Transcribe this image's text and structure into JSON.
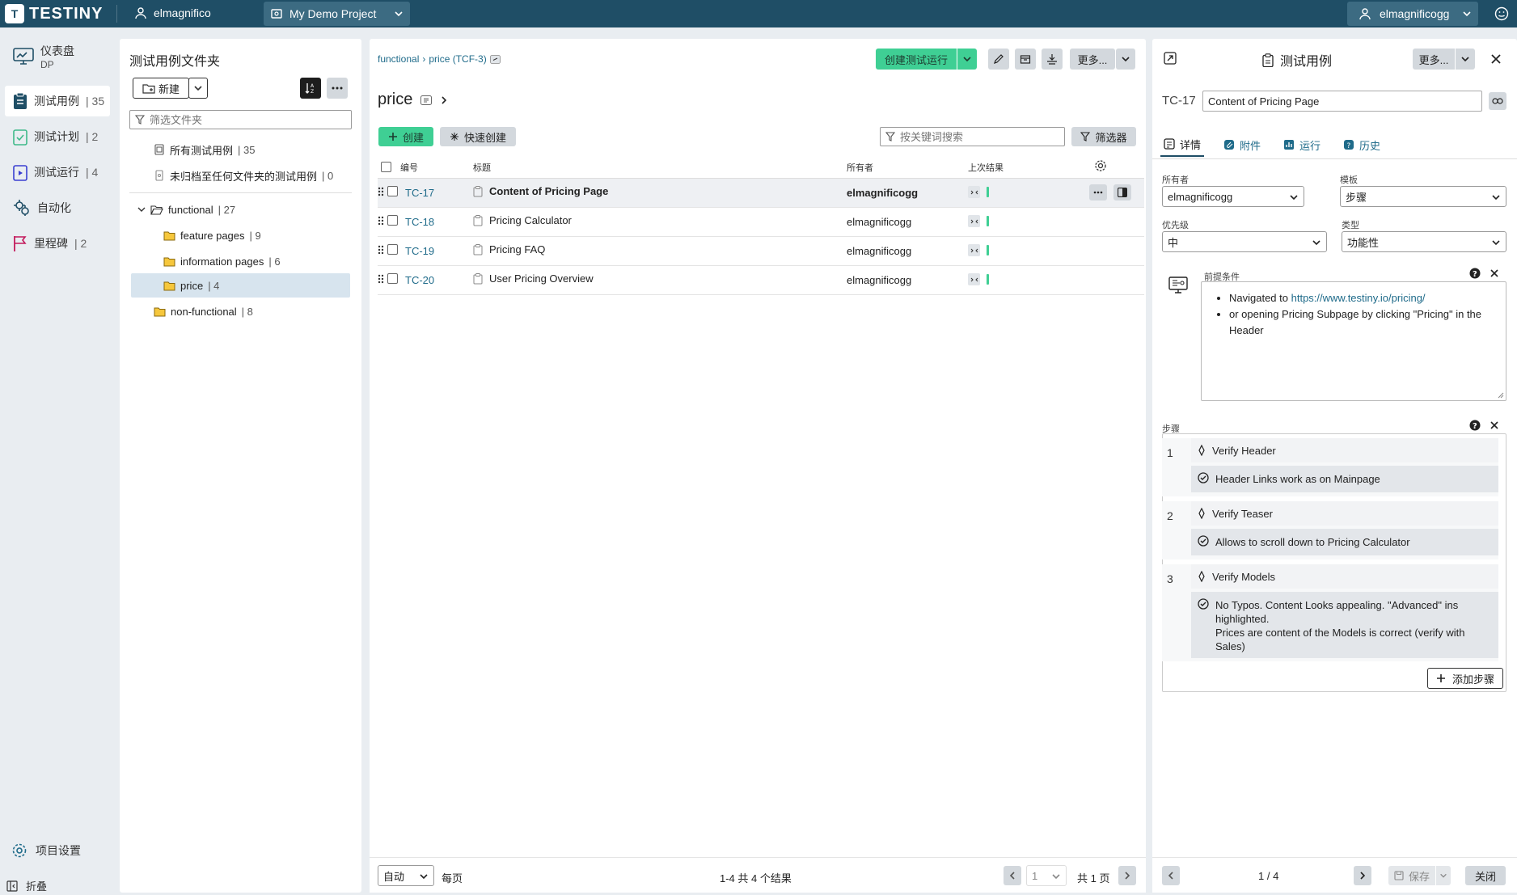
{
  "app": {
    "brand": "TESTINY",
    "org": "elmagnifico",
    "project": "My Demo Project",
    "user": "elmagnificogg"
  },
  "nav": {
    "items": [
      {
        "label": "仪表盘",
        "sub": "DP",
        "count": ""
      },
      {
        "label": "测试用例",
        "count": "| 35"
      },
      {
        "label": "测试计划",
        "count": "| 2"
      },
      {
        "label": "测试运行",
        "count": "| 4"
      },
      {
        "label": "自动化",
        "count": ""
      },
      {
        "label": "里程碑",
        "count": "| 2"
      }
    ],
    "settings": "项目设置",
    "collapse": "折叠"
  },
  "folders": {
    "title": "测试用例文件夹",
    "new_label": "新建",
    "filter_placeholder": "筛选文件夹",
    "all": {
      "label": "所有测试用例",
      "count": "| 35"
    },
    "unfiled": {
      "label": "未归档至任何文件夹的测试用例",
      "count": "| 0"
    },
    "tree": [
      {
        "label": "functional",
        "count": "| 27"
      },
      {
        "label": "feature pages",
        "count": "| 9"
      },
      {
        "label": "information pages",
        "count": "| 6"
      },
      {
        "label": "price",
        "count": "| 4"
      },
      {
        "label": "non-functional",
        "count": "| 8"
      }
    ]
  },
  "main": {
    "breadcrumb": {
      "parent": "functional",
      "sep": "›",
      "current": "price (TCF-3)"
    },
    "create_run": "创建测试运行",
    "more": "更多...",
    "heading": "price",
    "create": "创建",
    "quick_create": "快速创建",
    "search_placeholder": "按关键词搜索",
    "filter": "筛选器",
    "columns": {
      "id": "编号",
      "title": "标题",
      "owner": "所有者",
      "last_result": "上次结果"
    },
    "rows": [
      {
        "id": "TC-17",
        "title": "Content of Pricing Page",
        "owner": "elmagnificogg"
      },
      {
        "id": "TC-18",
        "title": "Pricing Calculator",
        "owner": "elmagnificogg"
      },
      {
        "id": "TC-19",
        "title": "Pricing FAQ",
        "owner": "elmagnificogg"
      },
      {
        "id": "TC-20",
        "title": "User Pricing Overview",
        "owner": "elmagnificogg"
      }
    ],
    "footer": {
      "per_page_value": "自动",
      "per_page_label": "每页",
      "summary": "1-4 共 4 个结果",
      "page": "1",
      "total_pages": "共 1 页"
    }
  },
  "detail": {
    "title": "测试用例",
    "more": "更多...",
    "tc_id": "TC-17",
    "tc_title": "Content of Pricing Page",
    "tabs": [
      "详情",
      "附件",
      "运行",
      "历史"
    ],
    "owner_label": "所有者",
    "owner_value": "elmagnificogg",
    "template_label": "模板",
    "template_value": "步骤",
    "priority_label": "优先级",
    "priority_value": "中",
    "type_label": "类型",
    "type_value": "功能性",
    "precond_label": "前提条件",
    "precond_1_prefix": "Navigated to ",
    "precond_1_link": "https://www.testiny.io/pricing/",
    "precond_2": "or opening Pricing Subpage by clicking \"Pricing\" in the Header",
    "steps_label": "步骤",
    "steps": [
      {
        "num": "1",
        "step": "Verify Header",
        "expected": "Header Links work as on Mainpage"
      },
      {
        "num": "2",
        "step": "Verify Teaser",
        "expected": "Allows to scroll down to Pricing Calculator"
      },
      {
        "num": "3",
        "step": "Verify Models",
        "expected": "No Typos. Content Looks appealing. \"Advanced\" ins highlighted.",
        "expected2": "Prices are content of the Models is correct (verify with Sales)"
      }
    ],
    "add_step": "添加步骤",
    "footer": {
      "pos": "1 / 4",
      "save": "保存",
      "close": "关闭"
    }
  }
}
